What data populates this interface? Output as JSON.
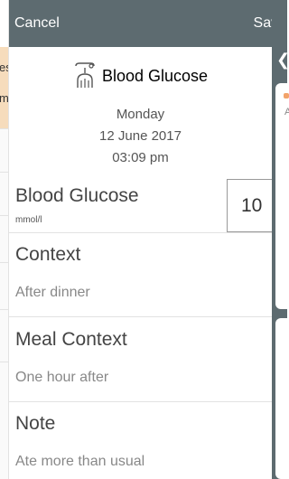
{
  "background": {
    "left_snippets": [
      "n",
      "es",
      "m"
    ],
    "right_snippet": "A"
  },
  "header": {
    "cancel_label": "Cancel",
    "save_label": "Save",
    "bar_color": "#5d6b70"
  },
  "entry": {
    "title": "Blood Glucose",
    "icon": "glucose-meter-icon",
    "day": "Monday",
    "date": "12 June 2017",
    "time": "03:09 pm"
  },
  "fields": {
    "glucose": {
      "label": "Blood Glucose",
      "unit": "mmol/l",
      "value": "10"
    },
    "context": {
      "label": "Context",
      "value": "After dinner"
    },
    "meal_context": {
      "label": "Meal Context",
      "value": "One hour after"
    },
    "note": {
      "label": "Note",
      "value": "Ate more than usual"
    }
  }
}
